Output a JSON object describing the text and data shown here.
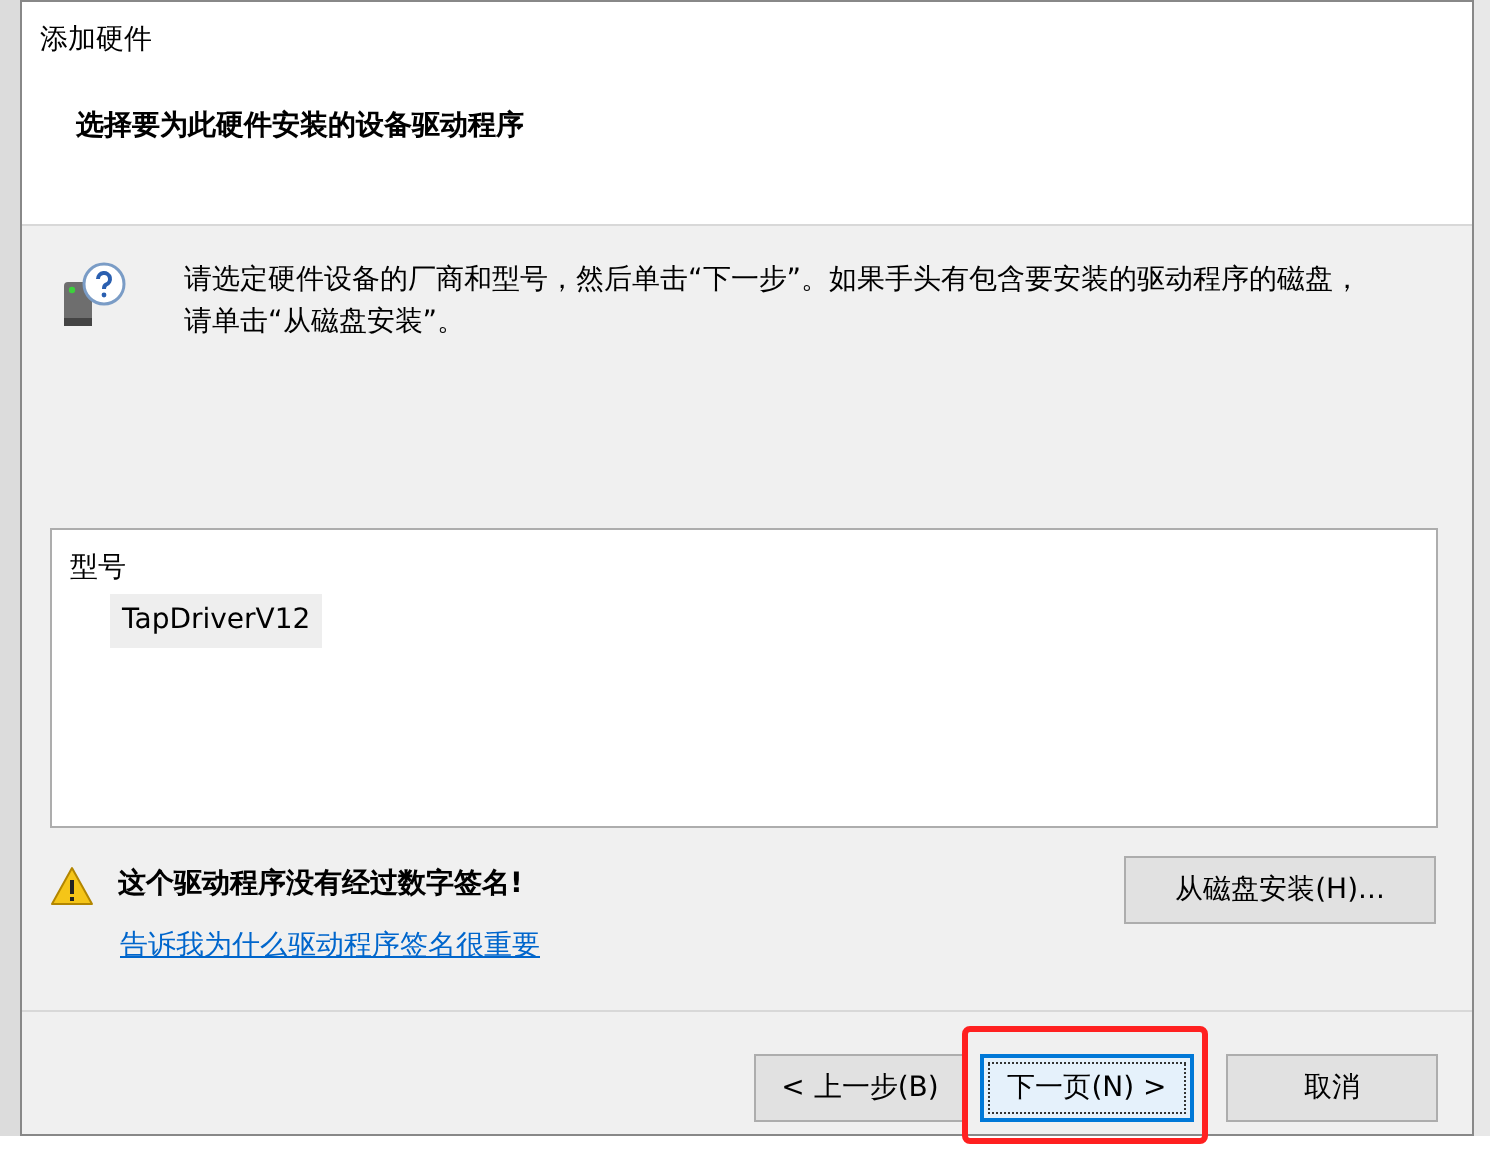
{
  "window": {
    "title": "添加硬件"
  },
  "header": {
    "heading": "选择要为此硬件安装的设备驱动程序"
  },
  "instruction": {
    "lines": [
      "请选定硬件设备的厂商和型号，然后单击“下一步”。如果手头有包含要安装的驱动程序的磁盘，",
      "请单击“从磁盘安装”。"
    ]
  },
  "model_list": {
    "column": "型号",
    "items": [
      {
        "label": "TapDriverV12",
        "selected": true
      }
    ]
  },
  "warning": {
    "text": "这个驱动程序没有经过数字签名!",
    "link": "告诉我为什么驱动程序签名很重要"
  },
  "disk_button": {
    "label": "从磁盘安装(H)..."
  },
  "buttons": [
    {
      "label": "< 上一步(B)",
      "focused": false,
      "highlighted": false
    },
    {
      "label": "下一页(N) >",
      "focused": true,
      "highlighted": true
    },
    {
      "label": "取消",
      "focused": false,
      "highlighted": false
    }
  ]
}
